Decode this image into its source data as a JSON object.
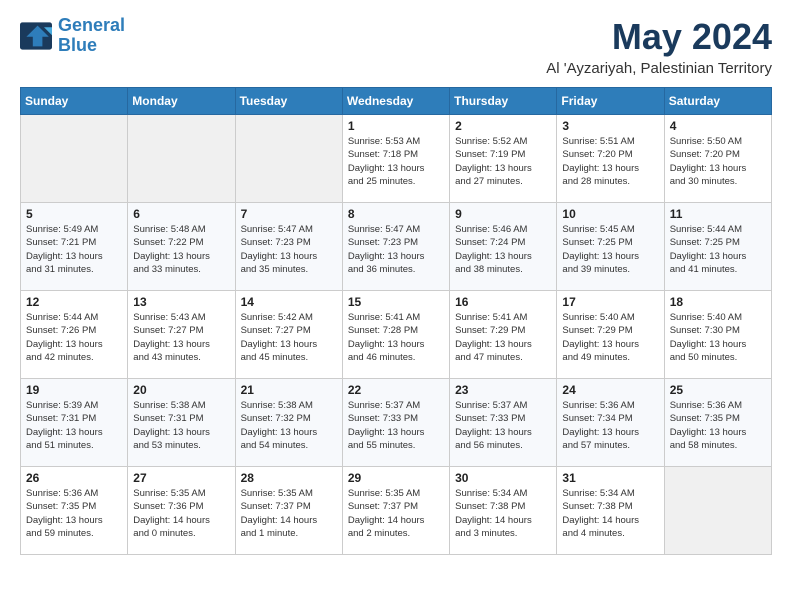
{
  "logo": {
    "line1": "General",
    "line2": "Blue"
  },
  "title": "May 2024",
  "location": "Al 'Ayzariyah, Palestinian Territory",
  "weekdays": [
    "Sunday",
    "Monday",
    "Tuesday",
    "Wednesday",
    "Thursday",
    "Friday",
    "Saturday"
  ],
  "weeks": [
    [
      {
        "day": "",
        "info": ""
      },
      {
        "day": "",
        "info": ""
      },
      {
        "day": "",
        "info": ""
      },
      {
        "day": "1",
        "info": "Sunrise: 5:53 AM\nSunset: 7:18 PM\nDaylight: 13 hours\nand 25 minutes."
      },
      {
        "day": "2",
        "info": "Sunrise: 5:52 AM\nSunset: 7:19 PM\nDaylight: 13 hours\nand 27 minutes."
      },
      {
        "day": "3",
        "info": "Sunrise: 5:51 AM\nSunset: 7:20 PM\nDaylight: 13 hours\nand 28 minutes."
      },
      {
        "day": "4",
        "info": "Sunrise: 5:50 AM\nSunset: 7:20 PM\nDaylight: 13 hours\nand 30 minutes."
      }
    ],
    [
      {
        "day": "5",
        "info": "Sunrise: 5:49 AM\nSunset: 7:21 PM\nDaylight: 13 hours\nand 31 minutes."
      },
      {
        "day": "6",
        "info": "Sunrise: 5:48 AM\nSunset: 7:22 PM\nDaylight: 13 hours\nand 33 minutes."
      },
      {
        "day": "7",
        "info": "Sunrise: 5:47 AM\nSunset: 7:23 PM\nDaylight: 13 hours\nand 35 minutes."
      },
      {
        "day": "8",
        "info": "Sunrise: 5:47 AM\nSunset: 7:23 PM\nDaylight: 13 hours\nand 36 minutes."
      },
      {
        "day": "9",
        "info": "Sunrise: 5:46 AM\nSunset: 7:24 PM\nDaylight: 13 hours\nand 38 minutes."
      },
      {
        "day": "10",
        "info": "Sunrise: 5:45 AM\nSunset: 7:25 PM\nDaylight: 13 hours\nand 39 minutes."
      },
      {
        "day": "11",
        "info": "Sunrise: 5:44 AM\nSunset: 7:25 PM\nDaylight: 13 hours\nand 41 minutes."
      }
    ],
    [
      {
        "day": "12",
        "info": "Sunrise: 5:44 AM\nSunset: 7:26 PM\nDaylight: 13 hours\nand 42 minutes."
      },
      {
        "day": "13",
        "info": "Sunrise: 5:43 AM\nSunset: 7:27 PM\nDaylight: 13 hours\nand 43 minutes."
      },
      {
        "day": "14",
        "info": "Sunrise: 5:42 AM\nSunset: 7:27 PM\nDaylight: 13 hours\nand 45 minutes."
      },
      {
        "day": "15",
        "info": "Sunrise: 5:41 AM\nSunset: 7:28 PM\nDaylight: 13 hours\nand 46 minutes."
      },
      {
        "day": "16",
        "info": "Sunrise: 5:41 AM\nSunset: 7:29 PM\nDaylight: 13 hours\nand 47 minutes."
      },
      {
        "day": "17",
        "info": "Sunrise: 5:40 AM\nSunset: 7:29 PM\nDaylight: 13 hours\nand 49 minutes."
      },
      {
        "day": "18",
        "info": "Sunrise: 5:40 AM\nSunset: 7:30 PM\nDaylight: 13 hours\nand 50 minutes."
      }
    ],
    [
      {
        "day": "19",
        "info": "Sunrise: 5:39 AM\nSunset: 7:31 PM\nDaylight: 13 hours\nand 51 minutes."
      },
      {
        "day": "20",
        "info": "Sunrise: 5:38 AM\nSunset: 7:31 PM\nDaylight: 13 hours\nand 53 minutes."
      },
      {
        "day": "21",
        "info": "Sunrise: 5:38 AM\nSunset: 7:32 PM\nDaylight: 13 hours\nand 54 minutes."
      },
      {
        "day": "22",
        "info": "Sunrise: 5:37 AM\nSunset: 7:33 PM\nDaylight: 13 hours\nand 55 minutes."
      },
      {
        "day": "23",
        "info": "Sunrise: 5:37 AM\nSunset: 7:33 PM\nDaylight: 13 hours\nand 56 minutes."
      },
      {
        "day": "24",
        "info": "Sunrise: 5:36 AM\nSunset: 7:34 PM\nDaylight: 13 hours\nand 57 minutes."
      },
      {
        "day": "25",
        "info": "Sunrise: 5:36 AM\nSunset: 7:35 PM\nDaylight: 13 hours\nand 58 minutes."
      }
    ],
    [
      {
        "day": "26",
        "info": "Sunrise: 5:36 AM\nSunset: 7:35 PM\nDaylight: 13 hours\nand 59 minutes."
      },
      {
        "day": "27",
        "info": "Sunrise: 5:35 AM\nSunset: 7:36 PM\nDaylight: 14 hours\nand 0 minutes."
      },
      {
        "day": "28",
        "info": "Sunrise: 5:35 AM\nSunset: 7:37 PM\nDaylight: 14 hours\nand 1 minute."
      },
      {
        "day": "29",
        "info": "Sunrise: 5:35 AM\nSunset: 7:37 PM\nDaylight: 14 hours\nand 2 minutes."
      },
      {
        "day": "30",
        "info": "Sunrise: 5:34 AM\nSunset: 7:38 PM\nDaylight: 14 hours\nand 3 minutes."
      },
      {
        "day": "31",
        "info": "Sunrise: 5:34 AM\nSunset: 7:38 PM\nDaylight: 14 hours\nand 4 minutes."
      },
      {
        "day": "",
        "info": ""
      }
    ]
  ]
}
